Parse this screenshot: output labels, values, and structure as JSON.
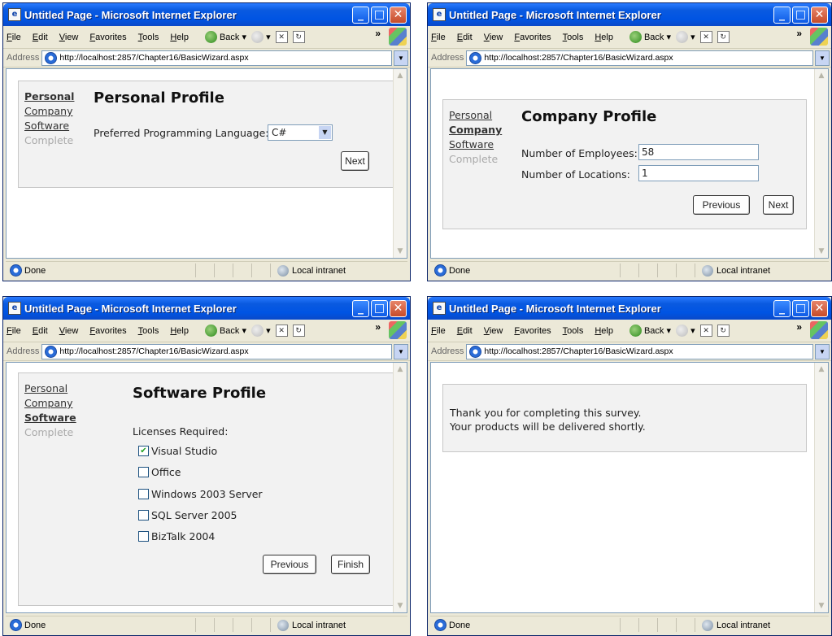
{
  "browser": {
    "title": "Untitled Page - Microsoft Internet Explorer",
    "menu": [
      "File",
      "Edit",
      "View",
      "Favorites",
      "Tools",
      "Help"
    ],
    "back_label": "Back",
    "address_label": "Address",
    "url": "http://localhost:2857/Chapter16/BasicWizard.aspx",
    "status": "Done",
    "zone": "Local intranet"
  },
  "wizard": {
    "steps": [
      "Personal",
      "Company",
      "Software",
      "Complete"
    ],
    "personal": {
      "title": "Personal Profile",
      "language_label": "Preferred Programming Language:",
      "language_value": "C#",
      "next": "Next"
    },
    "company": {
      "title": "Company Profile",
      "employees_label": "Number of Employees:",
      "employees_value": "58",
      "locations_label": "Number of Locations:",
      "locations_value": "1",
      "previous": "Previous",
      "next": "Next"
    },
    "software": {
      "title": "Software Profile",
      "licenses_label": "Licenses Required:",
      "licenses": [
        {
          "label": "Visual Studio",
          "checked": true
        },
        {
          "label": "Office",
          "checked": false
        },
        {
          "label": "Windows 2003 Server",
          "checked": false
        },
        {
          "label": "SQL Server 2005",
          "checked": false
        },
        {
          "label": "BizTalk 2004",
          "checked": false
        }
      ],
      "previous": "Previous",
      "finish": "Finish"
    },
    "complete": {
      "line1": "Thank you for completing this survey.",
      "line2": "Your products will be delivered shortly."
    }
  }
}
